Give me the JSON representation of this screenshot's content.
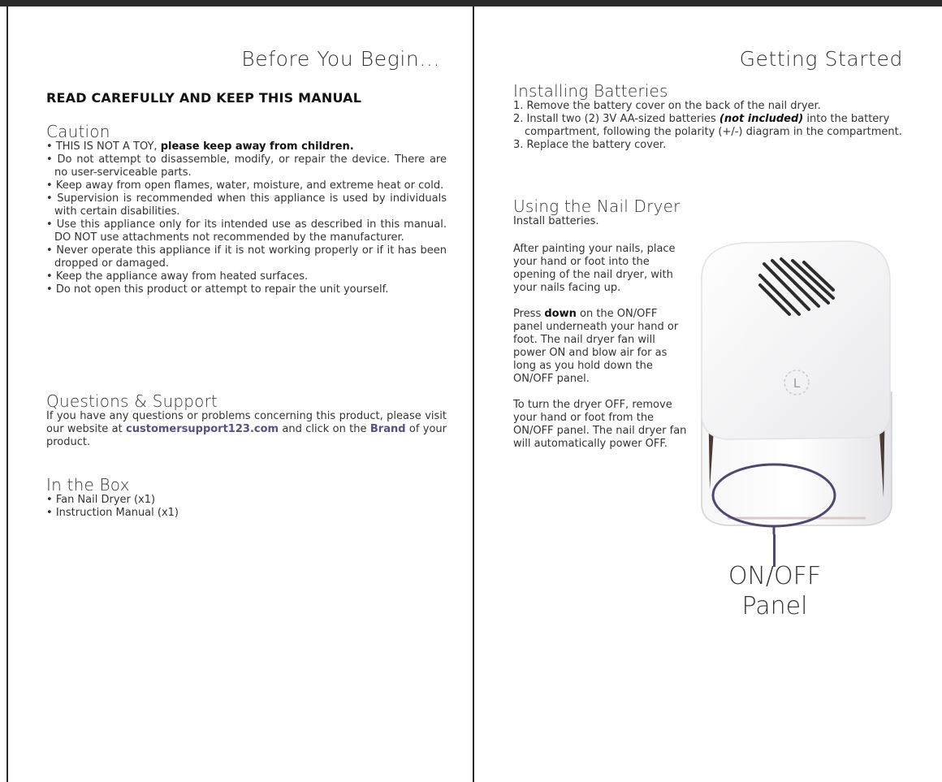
{
  "left": {
    "page_title": "Before You Begin...",
    "read_title": "READ CAREFULLY AND KEEP THIS MANUAL",
    "caution": {
      "title": "Caution",
      "item1_plain": "THIS IS NOT A TOY, ",
      "item1_bold": "please keep away from children.",
      "items": [
        "Do not attempt to disassemble, modify, or repair the device. There are no user-serviceable parts.",
        "Keep away from open flames, water, moisture, and extreme heat or cold.",
        "Supervision is recommended when this appliance is used by individuals with certain disabilities.",
        "Use this appliance only for its intended use as described in this manual. DO NOT use attachments not recommended by the manufacturer.",
        "Never operate this appliance if it is not working properly or if it has been dropped or damaged.",
        "Keep the appliance away from heated surfaces.",
        "Do not open this product or attempt to repair the unit yourself."
      ]
    },
    "support": {
      "title": "Questions & Support",
      "text_a": "If you have any questions or problems concerning this product, please visit our website at ",
      "link": "customersupport123.com",
      "text_b": " and click on the ",
      "brand": "Brand",
      "text_c": " of your product."
    },
    "box": {
      "title": "In the Box",
      "items": [
        "Fan Nail Dryer (x1)",
        "Instruction Manual (x1)"
      ]
    }
  },
  "right": {
    "page_title": "Getting Started",
    "batteries": {
      "title": "Installing Batteries",
      "step1": "1. Remove the battery cover on the back of the nail dryer.",
      "step2_a": "2. Install two (2) 3V AA-sized batteries ",
      "step2_em": "(not included)",
      "step2_b": " into the battery compartment, following the polarity (+/-) diagram in the compartment.",
      "step3": "3. Replace the battery cover."
    },
    "using": {
      "title": "Using the Nail Dryer",
      "intro": "Install batteries.",
      "para1": "After painting your nails, place your hand or foot into the opening of the nail dryer, with your nails facing up.",
      "para2_a": "Press ",
      "para2_bold": "down",
      "para2_b": " on the ON/OFF panel underneath your hand or foot. The nail dryer fan will power ON and blow air for as long as you hold down the ON/OFF panel.",
      "para3": "To turn the dryer OFF, remove your hand or foot from the ON/OFF panel. The nail dryer fan will automatically power OFF."
    },
    "callout_line1": "ON/OFF",
    "callout_line2": "Panel",
    "logo_letter": "L"
  },
  "colors": {
    "accent": "#5a4f82",
    "frame": "#2a2a2a",
    "callout": "#4e4870"
  }
}
